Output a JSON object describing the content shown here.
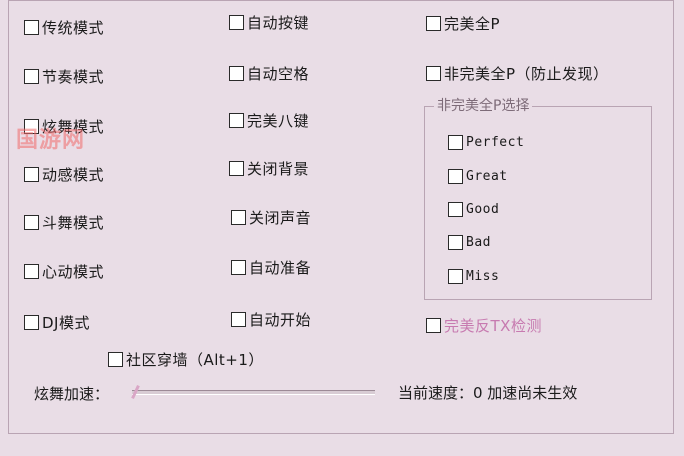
{
  "col1": [
    {
      "label": "传统模式",
      "checked": false
    },
    {
      "label": "节奏模式",
      "checked": false
    },
    {
      "label": "炫舞模式",
      "checked": false
    },
    {
      "label": "动感模式",
      "checked": false
    },
    {
      "label": "斗舞模式",
      "checked": false
    },
    {
      "label": "心动模式",
      "checked": false
    },
    {
      "label": "DJ模式",
      "checked": false
    }
  ],
  "col2": [
    {
      "label": "自动按键",
      "checked": false
    },
    {
      "label": "自动空格",
      "checked": false
    },
    {
      "label": "完美八键",
      "checked": false
    },
    {
      "label": "关闭背景",
      "checked": false
    },
    {
      "label": "关闭声音",
      "checked": false
    },
    {
      "label": "自动准备",
      "checked": false
    },
    {
      "label": "自动开始",
      "checked": false
    }
  ],
  "col3": [
    {
      "label": "完美全P",
      "checked": false
    },
    {
      "label": "非完美全P（防止发现）",
      "checked": false
    }
  ],
  "imperfect_group": {
    "title": "非完美全P选择",
    "options": [
      {
        "label": "Perfect",
        "checked": false
      },
      {
        "label": "Great",
        "checked": false
      },
      {
        "label": "Good",
        "checked": false
      },
      {
        "label": "Bad",
        "checked": false
      },
      {
        "label": "Miss",
        "checked": false
      }
    ]
  },
  "anti_tx": {
    "label": "完美反TX检测",
    "checked": false
  },
  "community": {
    "label": "社区穿墙（Alt+1）",
    "checked": false
  },
  "speed": {
    "label": "炫舞加速：",
    "status": "当前速度：0 加速尚未生效",
    "value": 0
  },
  "watermark": "国游网",
  "colors": {
    "background": "#e9dde6",
    "border": "#b9a4b3",
    "accent_pink": "#c77ab0"
  }
}
